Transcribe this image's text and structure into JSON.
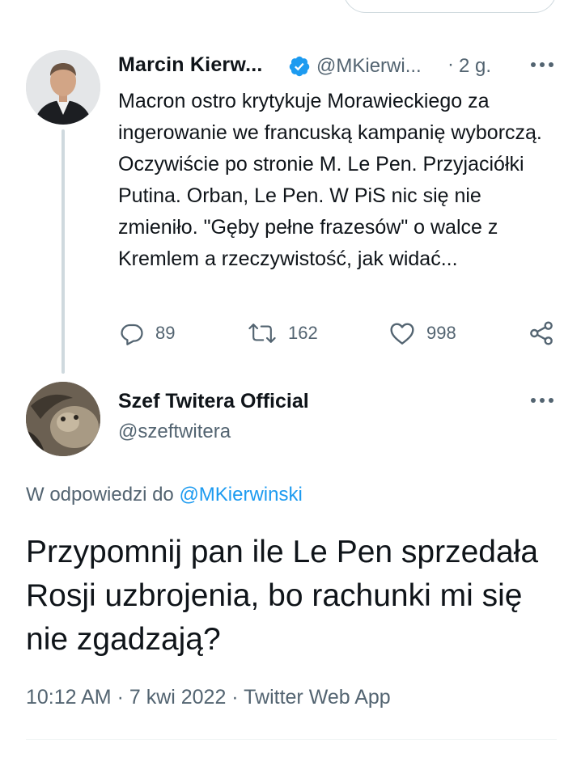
{
  "tweet1": {
    "name": "Marcin Kierw...",
    "handle": "@MKierwi...",
    "separator": "·",
    "time": "2 g.",
    "text": "Macron ostro krytykuje Morawieckiego za ingerowanie we francuską kampanię wyborczą. Oczywiście po stronie M. Le Pen. Przyjaciółki Putina. Orban, Le Pen. W PiS nic się nie zmieniło. \"Gęby pełne frazesów\" o walce z Kremlem a rzeczywistość, jak widać...",
    "replies": "89",
    "retweets": "162",
    "likes": "998"
  },
  "tweet2": {
    "name": "Szef Twitera Official",
    "handle": "@szeftwitera",
    "reply_prefix": "W odpowiedzi do ",
    "reply_handle": "@MKierwinski",
    "text": "Przypomnij pan ile Le Pen sprzedała Rosji uzbrojenia, bo rachunki mi się nie zgadzają?",
    "meta": "10:12 AM · 7 kwi 2022 · Twitter Web App"
  },
  "icons": {
    "verified": "verified-badge-icon",
    "more": "more-horizontal-icon",
    "reply": "reply-icon",
    "retweet": "retweet-icon",
    "like": "heart-icon",
    "share": "share-icon"
  },
  "colors": {
    "text": "#0f1419",
    "secondary": "#536471",
    "accent": "#1d9bf0",
    "thread_line": "#cfd9de"
  }
}
